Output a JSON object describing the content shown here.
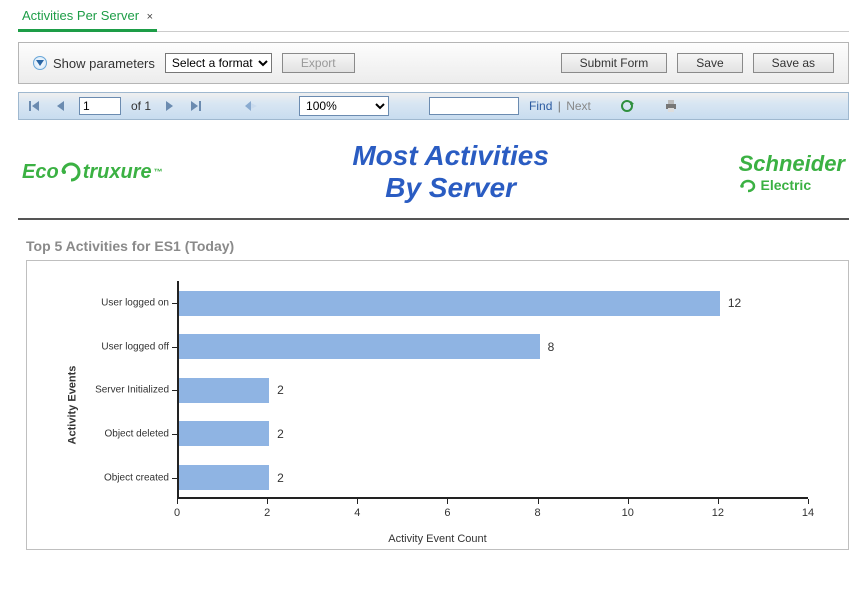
{
  "tab": {
    "label": "Activities Per Server"
  },
  "params": {
    "show_label": "Show parameters",
    "format_placeholder": "Select a format",
    "export_label": "Export",
    "submit_label": "Submit Form",
    "save_label": "Save",
    "saveas_label": "Save as"
  },
  "toolbar": {
    "page_value": "1",
    "of_label": "of",
    "page_total": "1",
    "zoom_value": "100%",
    "find_label": "Find",
    "next_label": "Next"
  },
  "header": {
    "eco_left": "Eco",
    "eco_right": "truxure",
    "title_line1": "Most Activities",
    "title_line2": "By Server",
    "schneider_top": "Schneider",
    "schneider_sub": "Electric"
  },
  "section": {
    "title": "Top 5 Activities for ES1 (Today)"
  },
  "chart_data": {
    "type": "bar",
    "orientation": "horizontal",
    "categories": [
      "User logged on",
      "User logged off",
      "Server Initialized",
      "Object deleted",
      "Object created"
    ],
    "values": [
      12,
      8,
      2,
      2,
      2
    ],
    "xlabel": "Activity Event Count",
    "ylabel": "Activity Events",
    "xlim": [
      0,
      14
    ],
    "xticks": [
      0,
      2,
      4,
      6,
      8,
      10,
      12,
      14
    ]
  }
}
